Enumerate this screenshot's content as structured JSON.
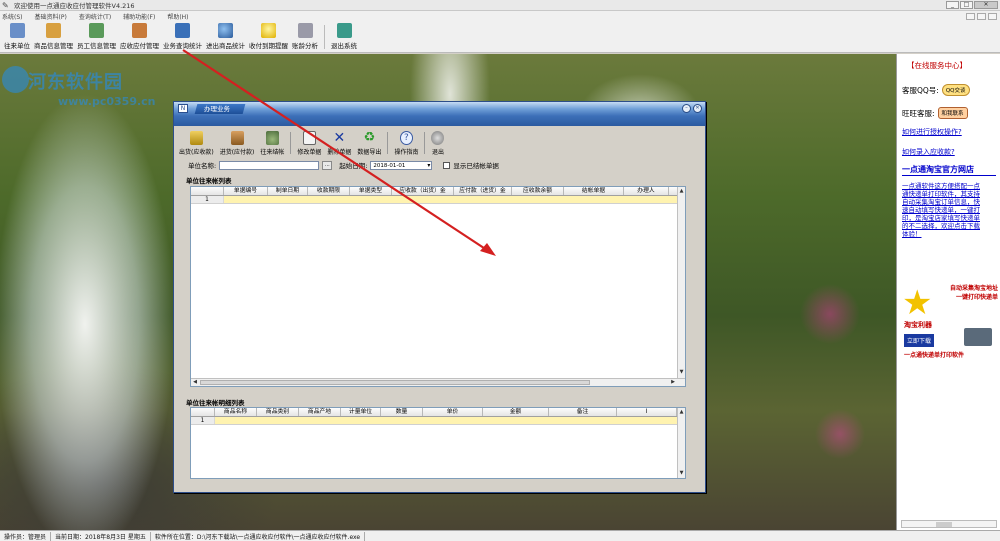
{
  "window": {
    "title": "欢迎使用一点通应收应付管理软件V4.216"
  },
  "menu": {
    "items": [
      "系统(S)",
      "基础资料(P)",
      "查询统计(T)",
      "辅助功能(F)",
      "帮助(H)"
    ]
  },
  "toolbar": {
    "items": [
      {
        "label": "往来单位",
        "icon": "partner-icon"
      },
      {
        "label": "商品信息管理",
        "icon": "product-icon"
      },
      {
        "label": "员工信息管理",
        "icon": "staff-icon"
      },
      {
        "label": "应收应付管理",
        "icon": "ledger-icon"
      },
      {
        "label": "业务查询统计",
        "icon": "query-icon"
      },
      {
        "label": "进出商品统计",
        "icon": "search-icon"
      },
      {
        "label": "收付到期提醒",
        "icon": "bulb-icon"
      },
      {
        "label": "账龄分析",
        "icon": "analysis-icon"
      },
      {
        "label": "退出系统",
        "icon": "exit-icon"
      }
    ]
  },
  "watermark": {
    "title": "河东软件园",
    "url": "www.pc0359.cn"
  },
  "dialog": {
    "title": "办理业务",
    "tools": [
      {
        "label": "出货(应收款)",
        "icon": "coins-gold-icon"
      },
      {
        "label": "进货(应付款)",
        "icon": "coins-brown-icon"
      },
      {
        "label": "往来结帐",
        "icon": "moneybag-icon"
      },
      {
        "label": "修改单据",
        "icon": "edit-doc-icon"
      },
      {
        "label": "删除单据",
        "icon": "delete-x-icon"
      },
      {
        "label": "数据导出",
        "icon": "recycle-icon"
      },
      {
        "label": "操作指南",
        "icon": "help-icon"
      },
      {
        "label": "退出",
        "icon": "exit-circle-icon"
      }
    ],
    "filter": {
      "unit_label": "单位名称:",
      "unit_value": "",
      "browse_label": "…",
      "date_label": "起始日期:",
      "date_value": "2018-01-01",
      "checkbox_label": "显示已结帐单据"
    },
    "list1": {
      "title": "单位往来帐列表",
      "columns": [
        "单据编号",
        "制单日期",
        "收款期限",
        "单据类型",
        "应收款（出货）金",
        "应付款（进货）金",
        "应收款余额",
        "结帐单据",
        "办理人"
      ],
      "row_number": "1"
    },
    "list2": {
      "title": "单位往来帐明细列表",
      "columns": [
        "商品名称",
        "商品类别",
        "商品产地",
        "计量单位",
        "数量",
        "单价",
        "金额",
        "备注",
        "I"
      ],
      "row_number": "1"
    }
  },
  "service_panel": {
    "header": "【在线服务中心】",
    "qq_label": "客服QQ号:",
    "qq_button": "QQ交谈",
    "ww_label": "旺旺客服:",
    "ww_button": "和我联系",
    "link1": "如何进行授权操作?",
    "link2": "如何录入应收款?",
    "shop_title": "一点通淘宝官方网店",
    "desc": "一点通软件这方便搭配一点通快递单打印软件，其支持自动采集淘宝订单信息，快速自动填写快递单，一键打印，是淘宝店家填写快递单的不二选择，欢迎点击下载体验！",
    "promo_line1": "自动采集淘宝地址",
    "promo_line2": "一键打印快递单",
    "promo_brand": "淘宝利器",
    "promo_button": "立即下载",
    "promo_footer": "一点通快递单打印软件"
  },
  "status": {
    "operator": "操作员：管理员",
    "date": "当前日期：2018年8月3日 星期五",
    "path": "软件所在位置：D:\\河东下载站\\一点通应收应付软件\\一点通应收应付软件.exe"
  },
  "colors": {
    "dialog_title_dark": "#2b5aa0",
    "selected_row": "#fff3b0",
    "arrow": "#d42020",
    "link": "#0000cc",
    "service_header": "#c00000"
  }
}
